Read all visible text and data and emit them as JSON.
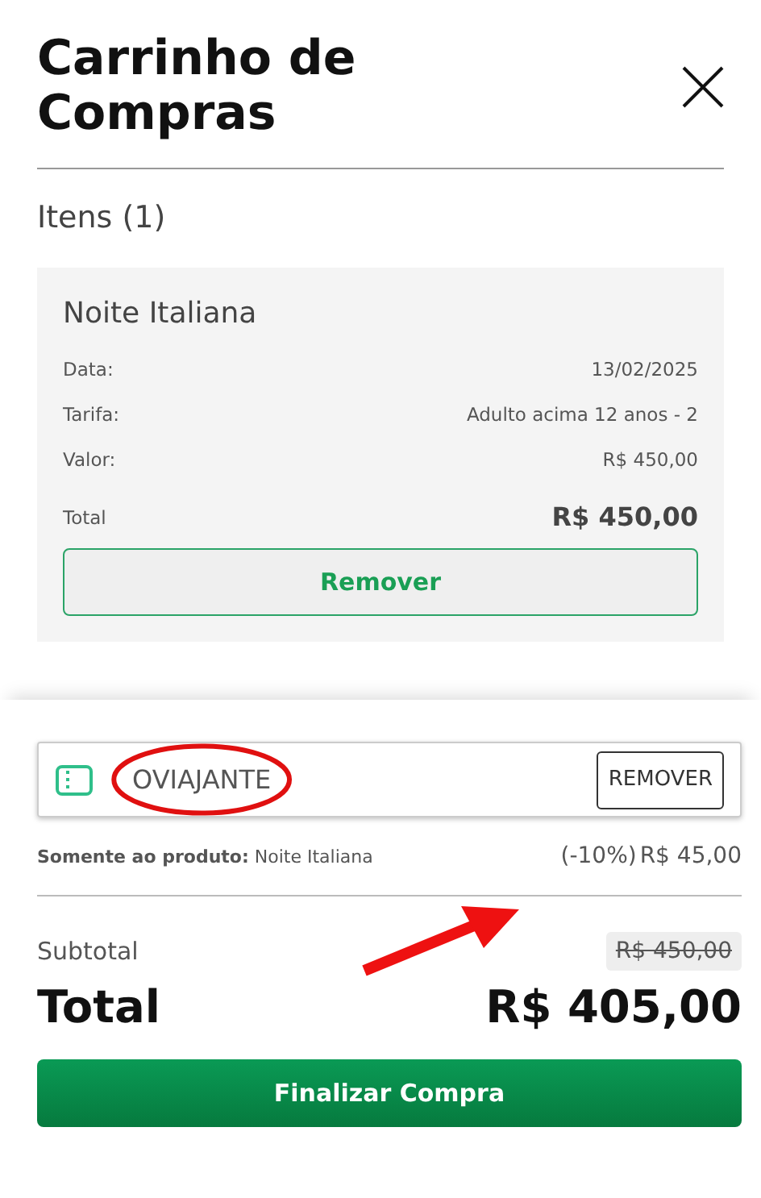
{
  "header": {
    "title": "Carrinho de Compras"
  },
  "items_heading": "Itens (1)",
  "items": [
    {
      "name": "Noite Italiana",
      "details": [
        {
          "label": "Data:",
          "value": "13/02/2025"
        },
        {
          "label": "Tarifa:",
          "value": "Adulto acima 12 anos - 2"
        },
        {
          "label": "Valor:",
          "value": "R$ 450,00"
        }
      ],
      "total_label": "Total",
      "total": "R$ 450,00",
      "remove_label": "Remover"
    }
  ],
  "coupon": {
    "code": "OVIAJANTE",
    "remove_label": "REMOVER",
    "scope": "**Somente ao produto:** Noite Italiana",
    "discount_percent": "(-10%)",
    "discount_value": "R$ 45,00"
  },
  "summary": {
    "subtotal_label": "Subtotal",
    "subtotal": "R$ 450,00",
    "total_label": "Total",
    "total": "R$ 405,00",
    "checkout_label": "Finalizar Compra"
  }
}
